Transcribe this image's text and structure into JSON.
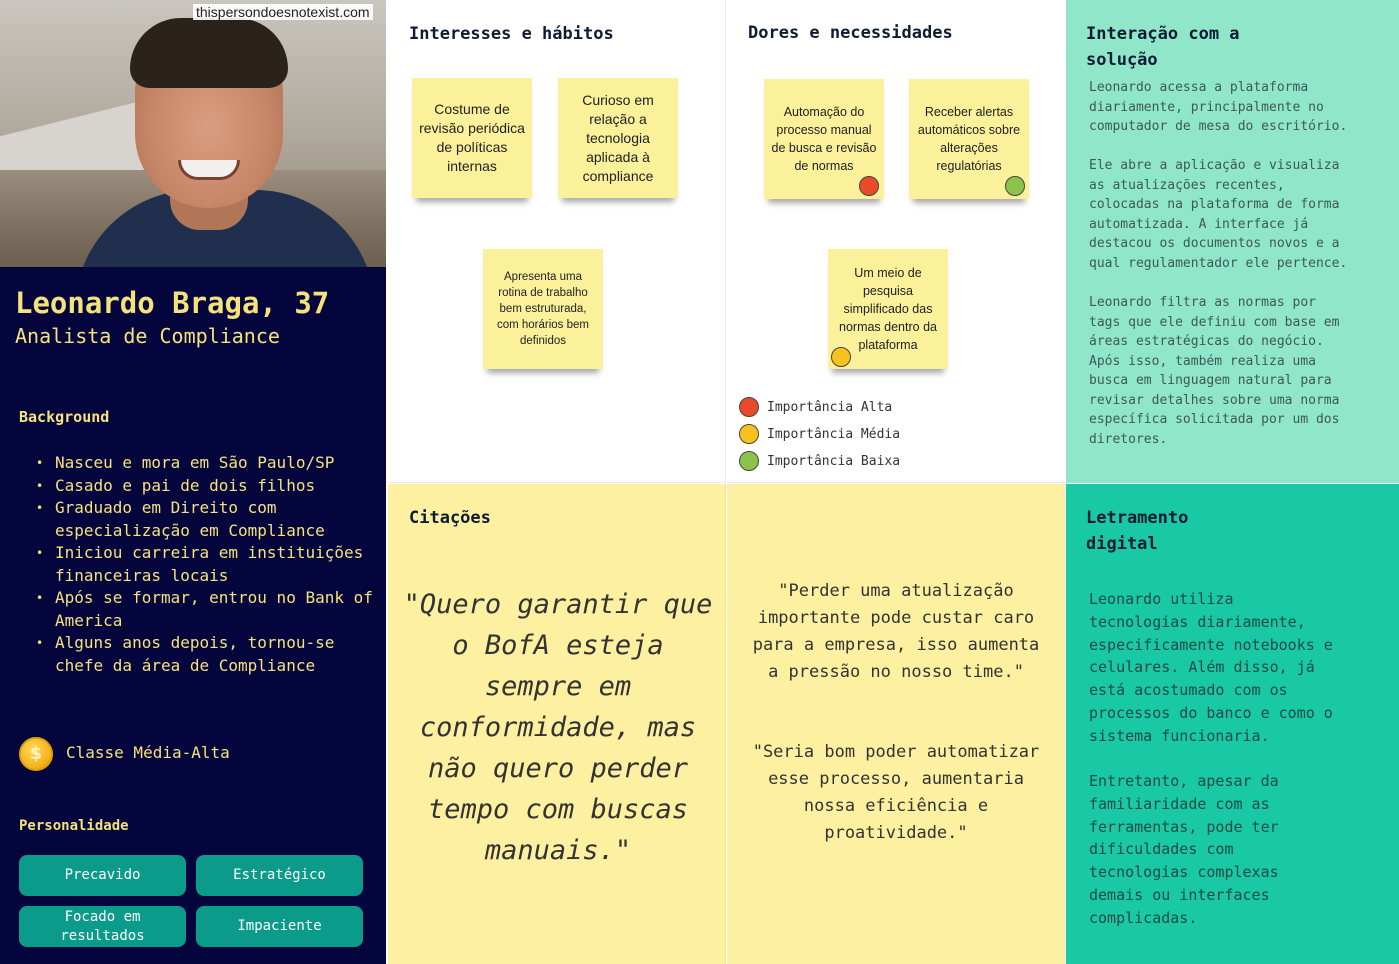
{
  "watermark": "thispersondoesnotexist.com",
  "persona": {
    "name": "Leonardo Braga, 37",
    "role": "Analista de Compliance",
    "background_title": "Background",
    "background_items": [
      "Nasceu e mora em São Paulo/SP",
      "Casado e pai de dois filhos",
      "Graduado em Direito com especialização em Compliance",
      "Iniciou carreira em instituições financeiras locais",
      "Após se formar, entrou no Bank of America",
      "Alguns anos depois, tornou-se chefe da área de Compliance"
    ],
    "coin_symbol": "$",
    "social_class": "Classe Média-Alta",
    "personality_title": "Personalidade",
    "traits": [
      "Precavido",
      "Estratégico",
      "Focado em resultados",
      "Impaciente"
    ]
  },
  "interests": {
    "title": "Interesses e hábitos",
    "notes": [
      "Costume de revisão periódica de políticas internas",
      "Curioso em relação a tecnologia aplicada à compliance",
      "Apresenta uma rotina de trabalho bem estruturada, com horários bem definidos"
    ]
  },
  "pains": {
    "title": "Dores e necessidades",
    "notes": [
      "Automação do processo manual de busca e revisão de normas",
      "Receber alertas automáticos sobre alterações regulatórias",
      "Um meio de pesquisa simplificado das normas dentro da plataforma"
    ],
    "note_importance": [
      "alta",
      "baixa",
      "media"
    ],
    "legend": [
      {
        "key": "alta",
        "label": "Importância Alta",
        "color": "#ea4a2a"
      },
      {
        "key": "media",
        "label": "Importância Média",
        "color": "#f7c21d"
      },
      {
        "key": "baixa",
        "label": "Importância Baixa",
        "color": "#8bc34a"
      }
    ]
  },
  "interaction": {
    "title": "Interação com a solução",
    "paragraphs": [
      "Leonardo acessa a plataforma\ndiariamente, principalmente no\ncomputador de mesa do escritório.",
      "Ele abre a aplicação e visualiza\nas atualizações recentes,\ncolocadas na plataforma de forma\nautomatizada. A interface já\ndestacou os documentos novos e a\nqual regulamentador ele pertence.",
      "Leonardo filtra as normas por\ntags que ele definiu com base em\náreas estratégicas do negócio.\nApós isso, também realiza uma\nbusca em linguagem natural para\nrevisar detalhes sobre uma norma\nespecífica solicitada por um dos\ndiretores."
    ]
  },
  "quotes": {
    "title": "Citações",
    "main": "\"Quero garantir que o BofA esteja sempre em conformidade, mas não quero perder tempo com buscas manuais.\"",
    "secondary": [
      "\"Perder uma atualização importante pode custar caro para a empresa, isso aumenta a pressão no nosso time.\"",
      "\"Seria bom poder automatizar esse processo, aumentaria nossa eficiência e proatividade.\""
    ]
  },
  "literacy": {
    "title": "Letramento digital",
    "paragraphs": [
      "Leonardo utiliza\ntecnologias diariamente,\nespecificamente notebooks e\ncelulares. Além disso, já\nestá acostumado com os\nprocessos do banco e como o\nsistema funcionaria.",
      "Entretanto, apesar da\nfamiliaridade com as\nferramentas, pode ter\ndificuldades com\ntecnologias complexas\ndemais ou interfaces\ncomplicadas."
    ]
  },
  "colors": {
    "navy": "#04053d",
    "accent_yellow": "#f6e27a",
    "teal_chip": "#0b9b8a",
    "mint_panel": "#8fe6c8",
    "teal_panel": "#19c9a5",
    "quote_panel": "#fdf0a0",
    "sticky": "#fbf19b"
  }
}
